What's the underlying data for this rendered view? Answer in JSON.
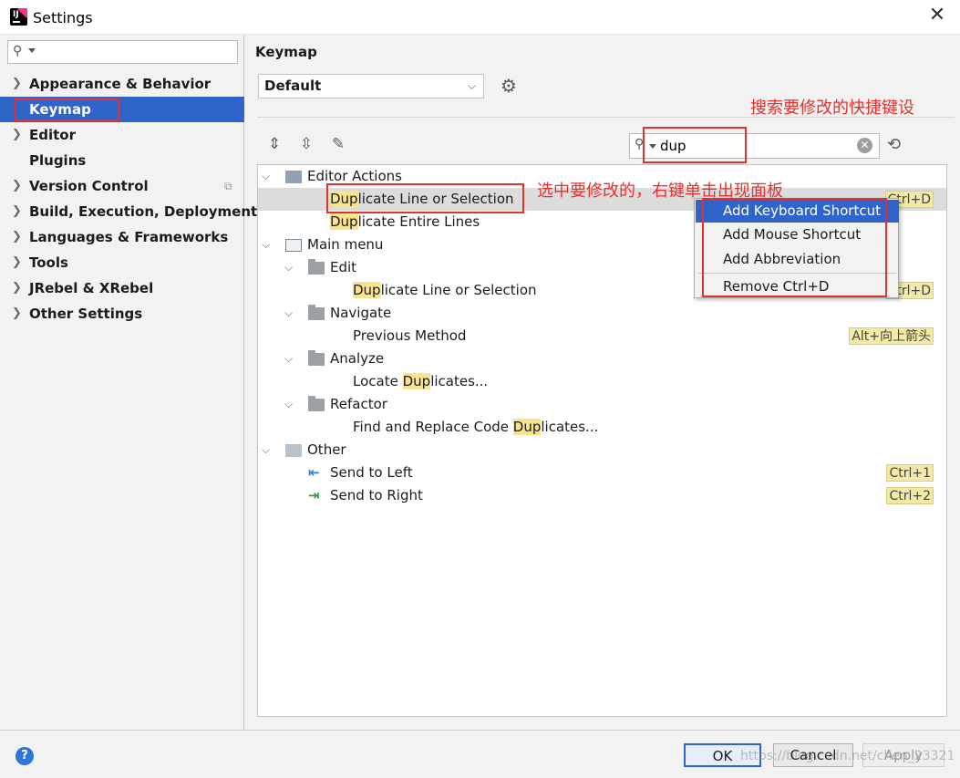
{
  "window": {
    "title": "Settings"
  },
  "sidebar": {
    "items": [
      {
        "label": "Appearance & Behavior",
        "expandable": true
      },
      {
        "label": "Keymap",
        "expandable": false
      },
      {
        "label": "Editor",
        "expandable": true
      },
      {
        "label": "Plugins",
        "expandable": false
      },
      {
        "label": "Version Control",
        "expandable": true
      },
      {
        "label": "Build, Execution, Deployment",
        "expandable": true
      },
      {
        "label": "Languages & Frameworks",
        "expandable": true
      },
      {
        "label": "Tools",
        "expandable": true
      },
      {
        "label": "JRebel & XRebel",
        "expandable": true
      },
      {
        "label": "Other Settings",
        "expandable": true
      }
    ],
    "selected": "Keymap"
  },
  "main": {
    "title": "Keymap",
    "keymap_value": "Default",
    "search_value": "dup"
  },
  "tree": {
    "editor_actions": {
      "label": "Editor Actions",
      "items": [
        {
          "hl": "Dup",
          "rest": "licate Line or Selection",
          "shortcut": "Ctrl+D"
        },
        {
          "hl": "Dup",
          "rest": "licate Entire Lines"
        }
      ]
    },
    "main_menu": {
      "label": "Main menu",
      "edit": {
        "label": "Edit",
        "item": {
          "hl": "Dup",
          "rest": "licate Line or Selection",
          "shortcut": "Ctrl+D"
        }
      },
      "navigate": {
        "label": "Navigate",
        "item": {
          "text": "Previous Method",
          "shortcut": "Alt+向上箭头"
        }
      },
      "analyze": {
        "label": "Analyze",
        "item": {
          "pre": "Locate ",
          "hl": "Dup",
          "rest": "licates..."
        }
      },
      "refactor": {
        "label": "Refactor",
        "item": {
          "pre": "Find and Replace Code ",
          "hl": "Dup",
          "rest": "licates..."
        }
      }
    },
    "other": {
      "label": "Other",
      "items": [
        {
          "text": "Send to Left",
          "shortcut": "Ctrl+1"
        },
        {
          "text": "Send to Right",
          "shortcut": "Ctrl+2"
        }
      ]
    }
  },
  "context_menu": {
    "items": [
      "Add Keyboard Shortcut",
      "Add Mouse Shortcut",
      "Add Abbreviation",
      "Remove Ctrl+D"
    ]
  },
  "annotations": {
    "search_note": "搜索要修改的快捷键设",
    "select_note": "选中要修改的，右键单击出现面板"
  },
  "footer": {
    "ok": "OK",
    "cancel": "Cancel",
    "apply": "Apply",
    "help": "?",
    "watermark": "https://blog.csdn.net/chen_23321"
  },
  "colors": {
    "selection": "#2f65ca",
    "annotation": "#e5312d",
    "highlight": "#f9e38f"
  },
  "icons": [
    "search-icon",
    "gear-icon",
    "expand-all-icon",
    "collapse-all-icon",
    "edit-icon",
    "find-shortcut-icon",
    "clear-icon",
    "folder-icon",
    "send-left-icon",
    "send-right-icon",
    "help-icon",
    "close-icon"
  ]
}
